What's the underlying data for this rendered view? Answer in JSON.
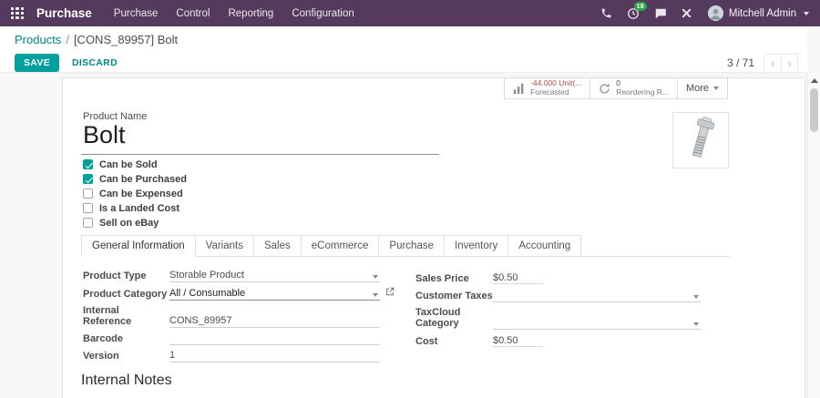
{
  "colors": {
    "topbar_bg": "#563a5e",
    "accent_teal": "#00a09d",
    "link_teal": "#008784",
    "badge_green": "#28a745",
    "negative_red": "#b94a48"
  },
  "topbar": {
    "app_name": "Purchase",
    "menus": [
      "Purchase",
      "Control",
      "Reporting",
      "Configuration"
    ],
    "activity_badge": "19",
    "user_name": "Mitchell Admin",
    "icons": [
      "apps-grid-icon",
      "phone-icon",
      "activity-clock-icon",
      "chat-icon",
      "close-icon"
    ]
  },
  "breadcrumb": {
    "parent": "Products",
    "separator": "/",
    "current": "[CONS_89957] Bolt"
  },
  "action_bar": {
    "save": "SAVE",
    "discard": "DISCARD",
    "pager": "3 / 71",
    "prev": "‹",
    "next": "›"
  },
  "stat_buttons": {
    "forecasted_value": "-44.000 Unit(...",
    "forecasted_label": "Forecasted",
    "reordering_value": "0",
    "reordering_label": "Reordering R...",
    "more_label": "More"
  },
  "product": {
    "name_label": "Product Name",
    "name": "Bolt",
    "checkboxes": [
      {
        "label": "Can be Sold",
        "checked": true
      },
      {
        "label": "Can be Purchased",
        "checked": true
      },
      {
        "label": "Can be Expensed",
        "checked": false
      },
      {
        "label": "Is a Landed Cost",
        "checked": false
      },
      {
        "label": "Sell on eBay",
        "checked": false
      }
    ]
  },
  "tabs": [
    {
      "label": "General Information",
      "active": true
    },
    {
      "label": "Variants",
      "active": false
    },
    {
      "label": "Sales",
      "active": false
    },
    {
      "label": "eCommerce",
      "active": false
    },
    {
      "label": "Purchase",
      "active": false
    },
    {
      "label": "Inventory",
      "active": false
    },
    {
      "label": "Accounting",
      "active": false
    }
  ],
  "fields": {
    "left": [
      {
        "label": "Product Type",
        "value": "Storable Product"
      },
      {
        "label": "Product Category",
        "value": "All / Consumable"
      },
      {
        "label": "Internal Reference",
        "value": "CONS_89957"
      },
      {
        "label": "Barcode",
        "value": ""
      },
      {
        "label": "Version",
        "value": "1"
      }
    ],
    "right": [
      {
        "label": "Sales Price",
        "value": "$0.50"
      },
      {
        "label": "Customer Taxes",
        "value": ""
      },
      {
        "label": "TaxCloud Category",
        "value": ""
      },
      {
        "label": "Cost",
        "value": "$0.50"
      }
    ]
  },
  "sections": {
    "internal_notes": "Internal Notes"
  }
}
